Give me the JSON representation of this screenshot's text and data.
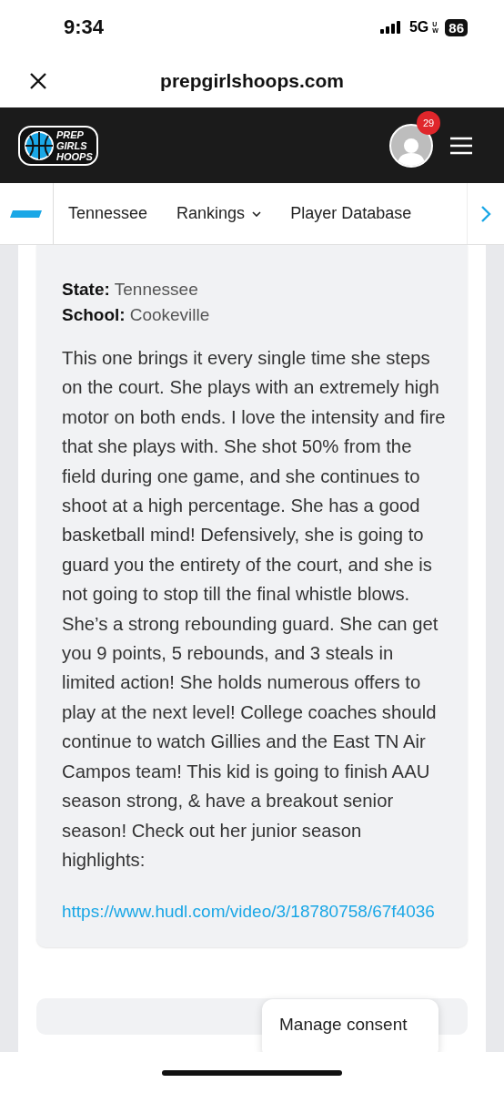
{
  "status_bar": {
    "time": "9:34",
    "network": "5G",
    "network_sub": "UW",
    "battery": "86"
  },
  "browser": {
    "domain": "prepgirlshoops.com"
  },
  "header": {
    "logo_lines": [
      "PREP",
      "GIRLS",
      "HOOPS"
    ],
    "notification_count": "29"
  },
  "subnav": {
    "items": [
      {
        "label": "Tennessee",
        "dropdown": false
      },
      {
        "label": "Rankings",
        "dropdown": true
      },
      {
        "label": "Player Database",
        "dropdown": false
      }
    ]
  },
  "profile": {
    "fields": [
      {
        "label": "State:",
        "value": "Tennessee"
      },
      {
        "label": "School:",
        "value": "Cookeville"
      }
    ],
    "description": "This one brings it every single time she steps on the court. She plays with an extremely high motor on both ends. I love the intensity and fire that she plays with. She shot 50% from the field during one game, and she continues to shoot at a high percentage. She has a good basketball mind! Defensively, she is going to guard you the entirety of the court, and she is not going to stop till the final whistle blows. She’s a strong rebounding guard. She can get you 9 points, 5 rebounds, and 3 steals in limited action! She holds numerous offers to play at the next level! College coaches should continue to watch Gillies and the East TN Air Campos team! This kid is going to finish AAU season strong, & have a breakout senior season! Check out her junior season highlights:",
    "link": "https://www.hudl.com/video/3/18780758/67f4036"
  },
  "consent_button": "Manage consent"
}
